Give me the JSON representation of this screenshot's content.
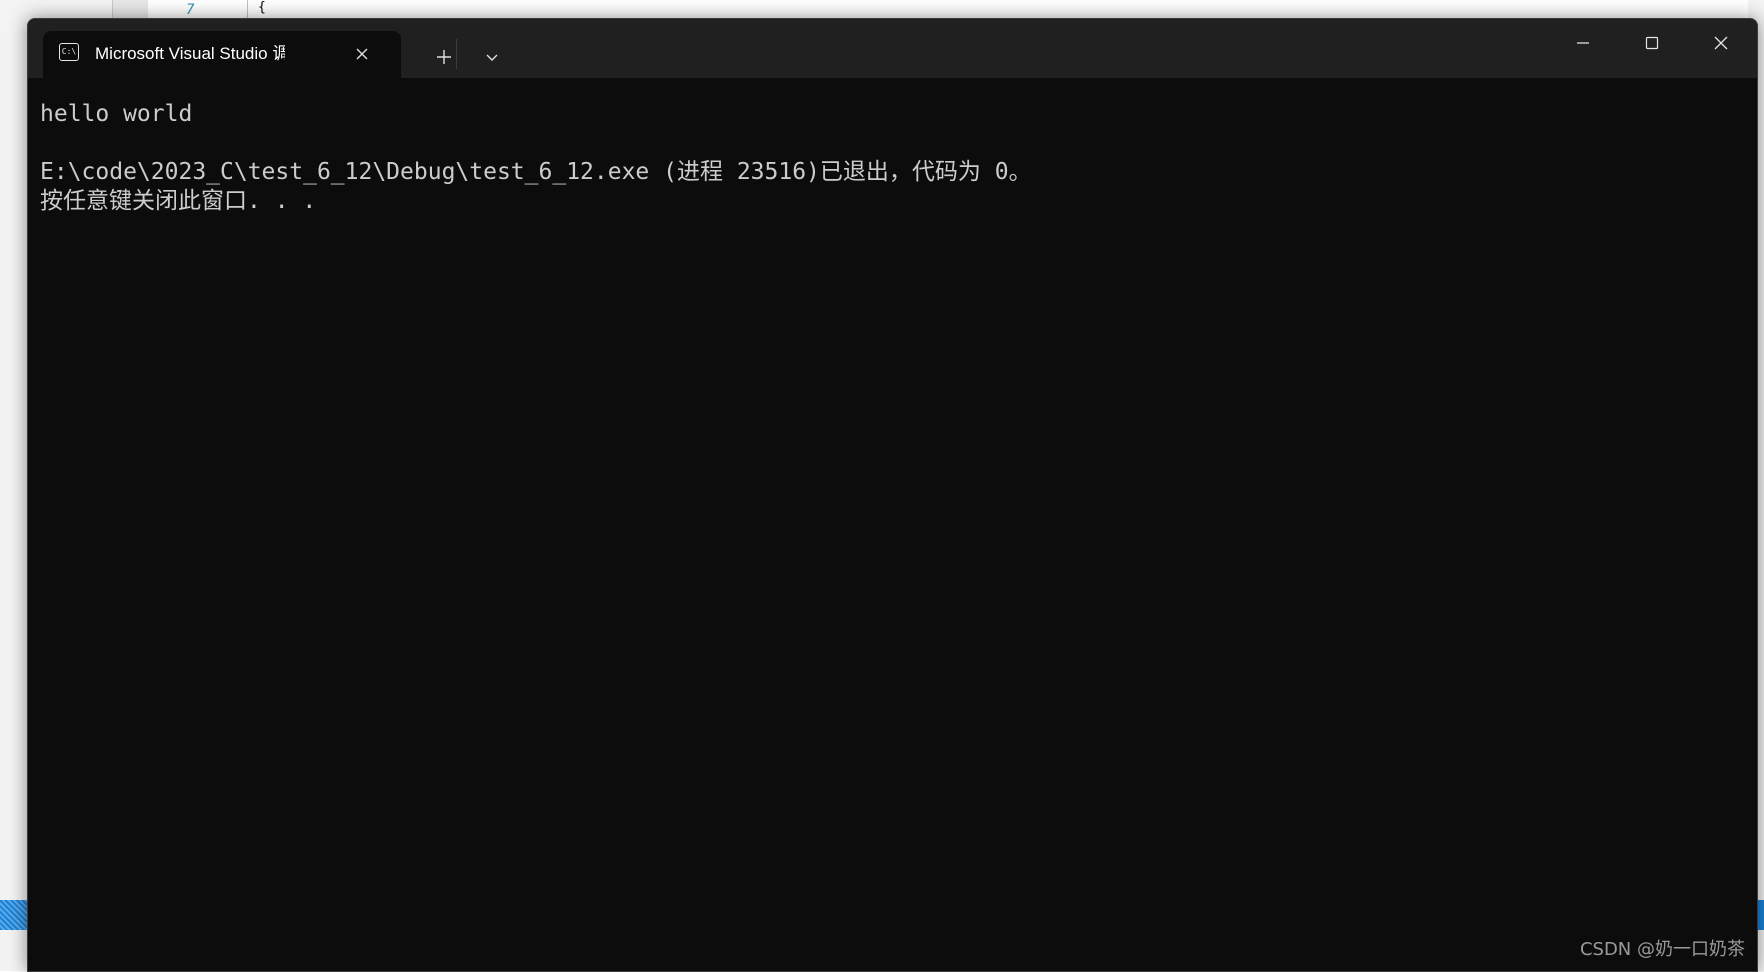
{
  "background": {
    "line_number": "7",
    "code_snippet": "{"
  },
  "window": {
    "tab": {
      "title": "Microsoft Visual Studio 调试控制台",
      "icon": "console-icon",
      "icon_text": "C:\\"
    },
    "controls": {
      "new_tab": "plus-icon",
      "dropdown": "chevron-down-icon",
      "minimize": "minimize-icon",
      "maximize": "maximize-icon",
      "close": "close-icon"
    }
  },
  "console": {
    "lines": [
      "hello world",
      "E:\\code\\2023_C\\test_6_12\\Debug\\test_6_12.exe (进程 23516)已退出，代码为 0。",
      "按任意键关闭此窗口. . ."
    ]
  },
  "watermark": "CSDN @奶一口奶茶",
  "colors": {
    "console_background": "#0c0c0c",
    "titlebar_background": "#202020",
    "console_text": "#cccccc"
  }
}
